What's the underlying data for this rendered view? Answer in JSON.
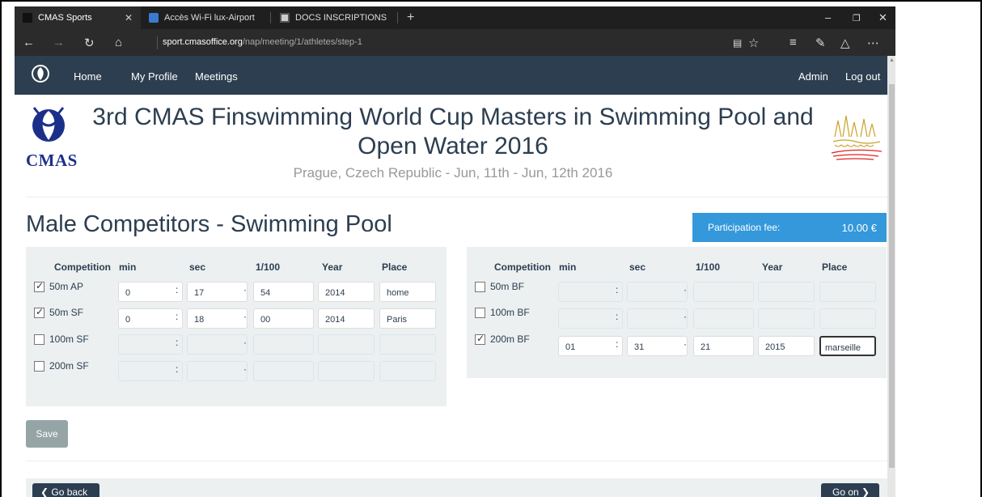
{
  "browser": {
    "tabs": [
      {
        "label": "CMAS Sports",
        "close": "✕"
      },
      {
        "label": "Accès Wi-Fi lux-Airport"
      },
      {
        "label": "DOCS INSCRIPTIONS"
      }
    ],
    "new_tab": "+",
    "url_host": "sport.cmasoffice.org",
    "url_path": "/nap/meeting/1/athletes/step-1"
  },
  "nav": {
    "home": "Home",
    "profile": "My Profile",
    "meetings": "Meetings",
    "admin": "Admin",
    "logout": "Log out"
  },
  "header": {
    "logo_text": "CMAS",
    "title": "3rd CMAS Finswimming World Cup Masters in Swimming Pool and Open Water 2016",
    "subtitle": "Prague, Czech Republic - Jun, 11th - Jun, 12th 2016"
  },
  "section_title": "Male Competitors - Swimming Pool",
  "fee": {
    "label": "Participation fee:",
    "value": "10.00 €"
  },
  "columns": {
    "competition": "Competition",
    "min": "min",
    "sec": "sec",
    "hundredths": "1/100",
    "year": "Year",
    "place": "Place"
  },
  "left_rows": [
    {
      "label": "50m AP",
      "checked": true,
      "min": "0",
      "sec": "17",
      "hund": "54",
      "year": "2014",
      "place": "home"
    },
    {
      "label": "50m SF",
      "checked": true,
      "min": "0",
      "sec": "18",
      "hund": "00",
      "year": "2014",
      "place": "Paris"
    },
    {
      "label": "100m SF",
      "checked": false,
      "min": "",
      "sec": "",
      "hund": "",
      "year": "",
      "place": ""
    },
    {
      "label": "200m SF",
      "checked": false,
      "min": "",
      "sec": "",
      "hund": "",
      "year": "",
      "place": ""
    }
  ],
  "right_rows": [
    {
      "label": "50m BF",
      "checked": false,
      "min": "",
      "sec": "",
      "hund": "",
      "year": "",
      "place": ""
    },
    {
      "label": "100m BF",
      "checked": false,
      "min": "",
      "sec": "",
      "hund": "",
      "year": "",
      "place": ""
    },
    {
      "label": "200m BF",
      "checked": true,
      "min": "01",
      "sec": "31",
      "hund": "21",
      "year": "2015",
      "place": "marseille"
    }
  ],
  "separators": {
    "colon": ":",
    "dot": "·"
  },
  "buttons": {
    "save": "Save",
    "go_back": "Go back",
    "go_on": "Go on"
  }
}
